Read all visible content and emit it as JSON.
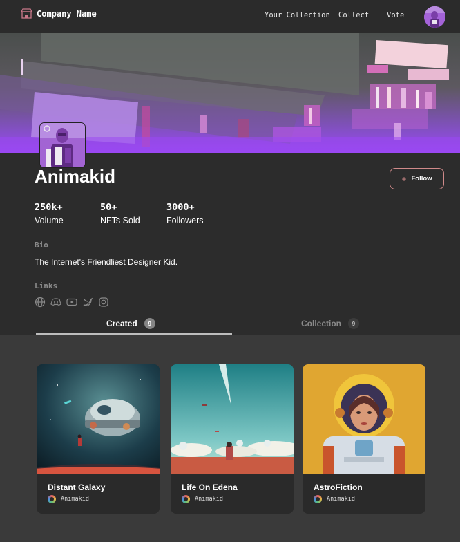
{
  "brand": {
    "name": "Company Name",
    "icon": "storefront-icon"
  },
  "nav": {
    "links": [
      "Your Collection",
      "Collect",
      "Vote"
    ],
    "avatar_icon": "user-avatar"
  },
  "profile": {
    "name": "Animakid",
    "follow_label": "Follow",
    "stats": [
      {
        "value": "250k+",
        "label": "Volume"
      },
      {
        "value": "50+",
        "label": "NFTs Sold"
      },
      {
        "value": "3000+",
        "label": "Followers"
      }
    ],
    "bio_label": "Bio",
    "bio": "The Internet's Friendliest Designer Kid.",
    "links_label": "Links",
    "links": [
      "globe-icon",
      "discord-icon",
      "youtube-icon",
      "twitter-icon",
      "instagram-icon"
    ]
  },
  "tabs": [
    {
      "label": "Created",
      "count": "9",
      "active": true
    },
    {
      "label": "Collection",
      "count": "9",
      "active": false
    }
  ],
  "cards": [
    {
      "title": "Distant Galaxy",
      "author": "Animakid"
    },
    {
      "title": "Life On Edena",
      "author": "Animakid"
    },
    {
      "title": "AstroFiction",
      "author": "Animakid"
    }
  ],
  "colors": {
    "accent_purple": "#a259ff",
    "follow_border": "#d08a8a",
    "page_bg": "#3a3a3a",
    "nav_bg": "#2b2b2b"
  }
}
